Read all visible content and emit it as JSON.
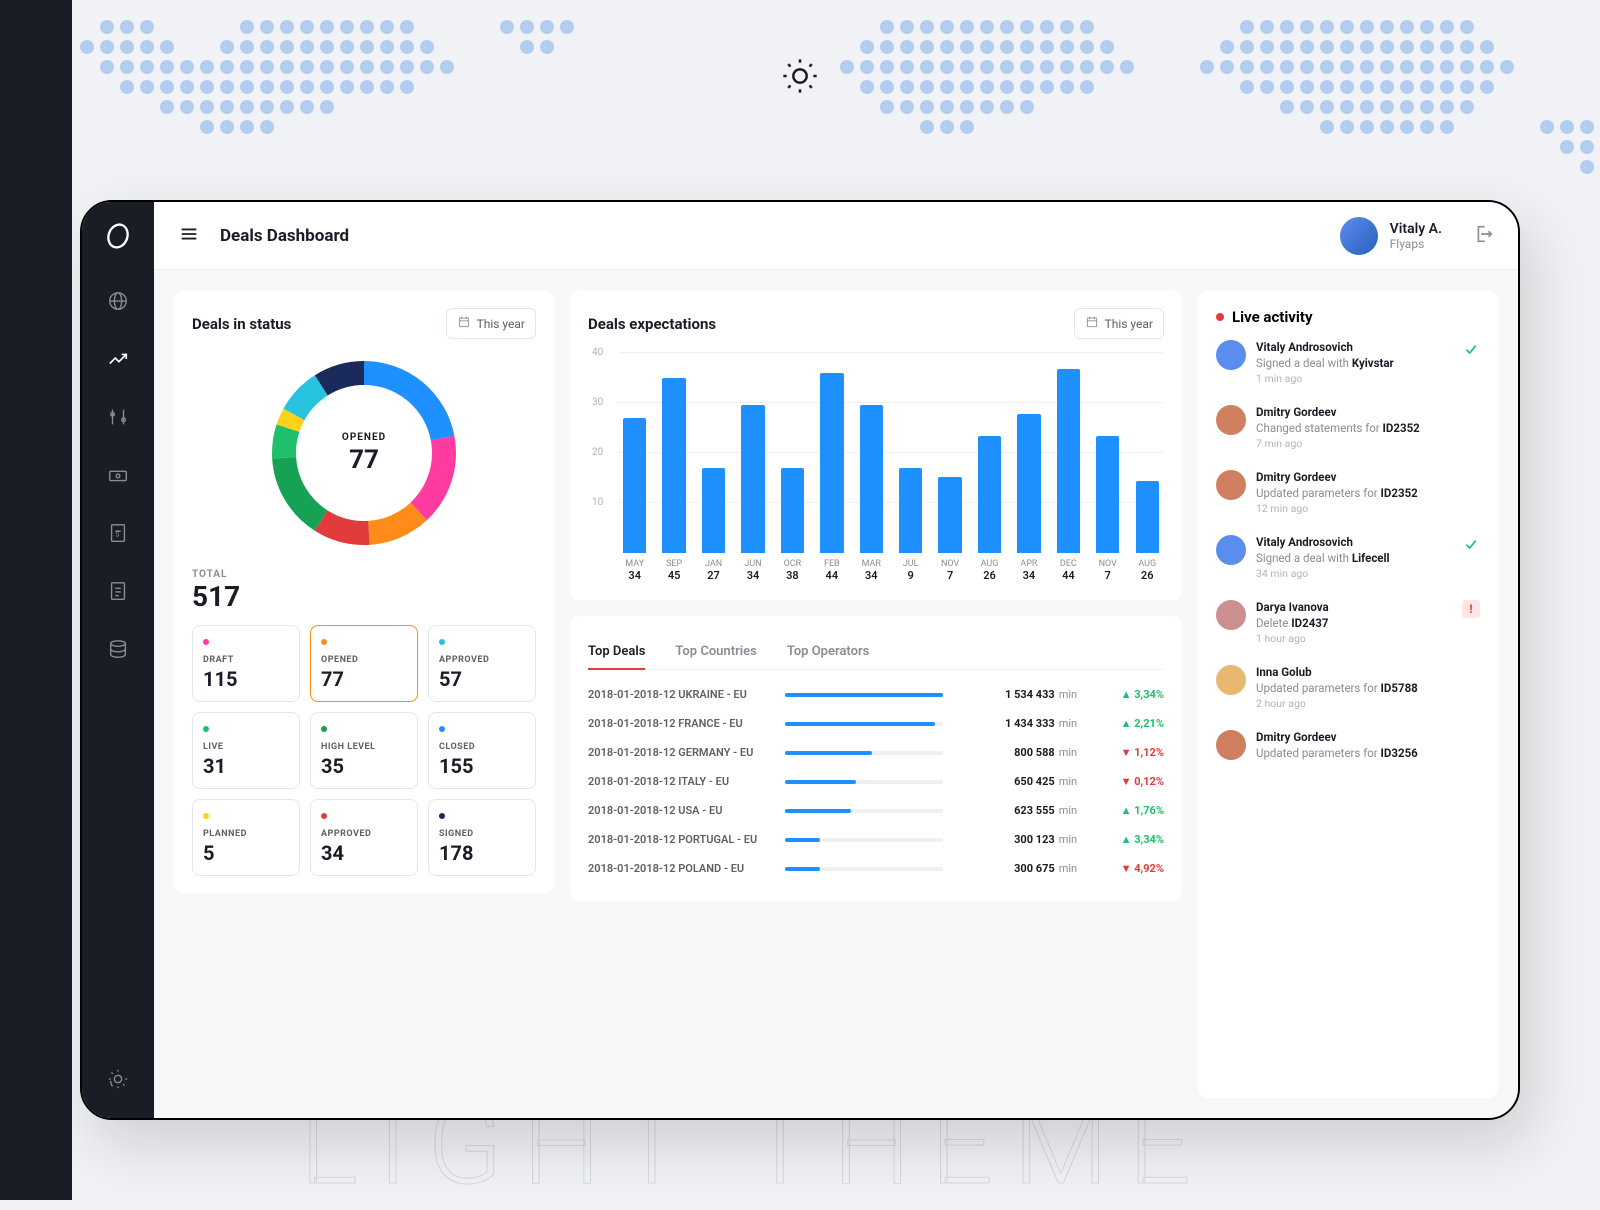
{
  "page_title": "Deals Dashboard",
  "user": {
    "name": "Vitaly A.",
    "sub": "Flyaps"
  },
  "watermark": "LIGHT THEME",
  "status_card": {
    "title": "Deals in status",
    "period": "This year",
    "center_label": "OPENED",
    "center_value": "77",
    "total_label": "TOTAL",
    "total_value": "517",
    "items": [
      {
        "name": "DRAFT",
        "value": "115",
        "color": "#ff3ba0"
      },
      {
        "name": "OPENED",
        "value": "77",
        "color": "#ff8c1a",
        "active": true
      },
      {
        "name": "APPROVED",
        "value": "57",
        "color": "#27c2e0"
      },
      {
        "name": "LIVE",
        "value": "31",
        "color": "#1fbf6b"
      },
      {
        "name": "HIGH LEVEL",
        "value": "35",
        "color": "#15a255"
      },
      {
        "name": "CLOSED",
        "value": "155",
        "color": "#1e90ff"
      },
      {
        "name": "PLANNED",
        "value": "5",
        "color": "#ffd21a"
      },
      {
        "name": "APPROVED",
        "value": "34",
        "color": "#e23b3b"
      },
      {
        "name": "SIGNED",
        "value": "178",
        "color": "#1a2a5b"
      }
    ],
    "donut_segments": [
      {
        "color": "#1e90ff",
        "pct": 22
      },
      {
        "color": "#ff3ba0",
        "pct": 16
      },
      {
        "color": "#ff8c1a",
        "pct": 11
      },
      {
        "color": "#e23b3b",
        "pct": 10
      },
      {
        "color": "#15a255",
        "pct": 15
      },
      {
        "color": "#1fbf6b",
        "pct": 6
      },
      {
        "color": "#ffd21a",
        "pct": 3
      },
      {
        "color": "#27c2e0",
        "pct": 8
      },
      {
        "color": "#1a2a5b",
        "pct": 9
      }
    ]
  },
  "chart_data": {
    "type": "bar",
    "title": "Deals expectations",
    "period": "This year",
    "ylabel": "",
    "ylim": [
      0,
      40
    ],
    "yticks": [
      10,
      20,
      30,
      40
    ],
    "categories": [
      "MAY",
      "SEP",
      "JAN",
      "JUN",
      "OCR",
      "FEB",
      "MAR",
      "JUL",
      "NOV",
      "AUG",
      "APR",
      "DEC",
      "NOV",
      "AUG"
    ],
    "values": [
      30,
      39,
      19,
      33,
      19,
      40,
      33,
      19,
      17,
      26,
      31,
      41,
      26,
      16
    ],
    "bar_labels": [
      "34",
      "45",
      "27",
      "34",
      "38",
      "44",
      "34",
      "9",
      "7",
      "26",
      "34",
      "44",
      "7",
      "26"
    ]
  },
  "top_deals": {
    "tabs": [
      "Top Deals",
      "Top Countries",
      "Top Operators"
    ],
    "rows": [
      {
        "name": "2018-01-2018-12 UKRAINE - EU",
        "pct": 100,
        "value": "1 534 433",
        "unit": "min",
        "delta": "3,34%",
        "dir": "up"
      },
      {
        "name": "2018-01-2018-12 FRANCE - EU",
        "pct": 95,
        "value": "1 434 333",
        "unit": "min",
        "delta": "2,21%",
        "dir": "up"
      },
      {
        "name": "2018-01-2018-12 GERMANY - EU",
        "pct": 55,
        "value": "800 588",
        "unit": "min",
        "delta": "1,12%",
        "dir": "down"
      },
      {
        "name": "2018-01-2018-12 ITALY - EU",
        "pct": 45,
        "value": "650 425",
        "unit": "min",
        "delta": "0,12%",
        "dir": "down"
      },
      {
        "name": "2018-01-2018-12 USA - EU",
        "pct": 42,
        "value": "623 555",
        "unit": "min",
        "delta": "1,76%",
        "dir": "up"
      },
      {
        "name": "2018-01-2018-12 PORTUGAL - EU",
        "pct": 22,
        "value": "300 123",
        "unit": "min",
        "delta": "3,34%",
        "dir": "up"
      },
      {
        "name": "2018-01-2018-12 POLAND - EU",
        "pct": 22,
        "value": "300 675",
        "unit": "min",
        "delta": "4,92%",
        "dir": "down"
      }
    ]
  },
  "live": {
    "title": "Live activity",
    "items": [
      {
        "name": "Vitaly Androsovich",
        "desc_pre": "Signed a deal with",
        "desc_bold": "Kyivstar",
        "time": "1 min ago",
        "flag": "ok"
      },
      {
        "name": "Dmitry Gordeev",
        "desc_pre": "Changed statements for",
        "desc_bold": "ID2352",
        "time": "7 min ago"
      },
      {
        "name": "Dmitry Gordeev",
        "desc_pre": "Updated parameters for",
        "desc_bold": "ID2352",
        "time": "12 min ago"
      },
      {
        "name": "Vitaly Androsovich",
        "desc_pre": "Signed a deal with",
        "desc_bold": "Lifecell",
        "time": "34 min ago",
        "flag": "ok"
      },
      {
        "name": "Darya Ivanova",
        "desc_pre": "Delete",
        "desc_bold": "ID2437",
        "time": "1 hour ago",
        "flag": "warn"
      },
      {
        "name": "Inna Golub",
        "desc_pre": "Updated parameters for",
        "desc_bold": "ID5788",
        "time": "2 hour ago"
      },
      {
        "name": "Dmitry Gordeev",
        "desc_pre": "Updated parameters for",
        "desc_bold": "ID3256",
        "time": ""
      }
    ]
  },
  "avatar_colors": [
    "#5b8def",
    "#d08060",
    "#d08060",
    "#5b8def",
    "#cc8f8f",
    "#e8b870",
    "#d08060"
  ]
}
